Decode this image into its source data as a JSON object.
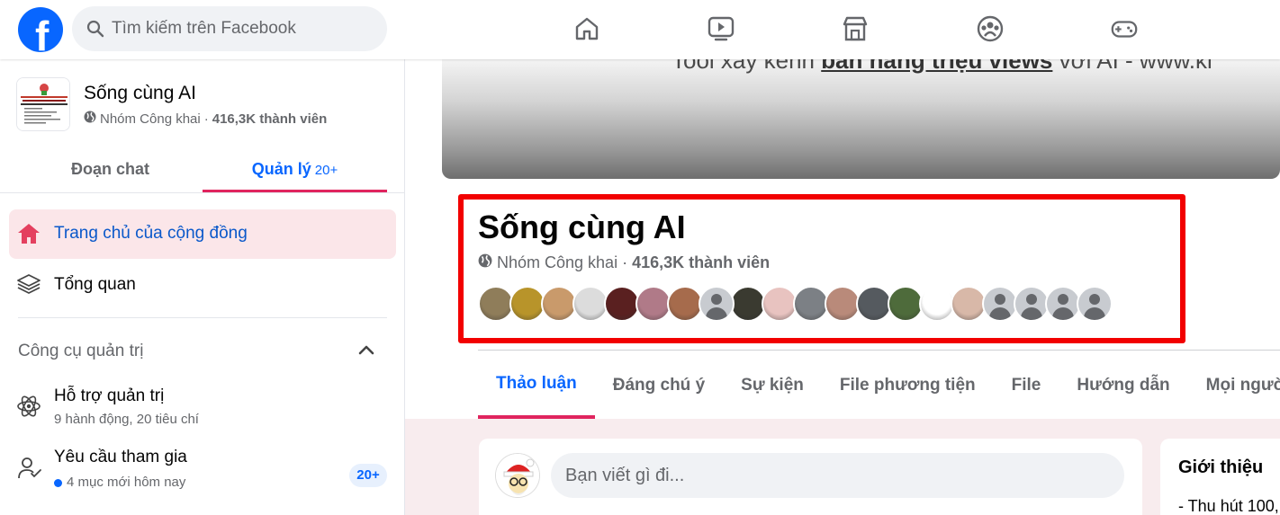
{
  "search": {
    "placeholder": "Tìm kiếm trên Facebook"
  },
  "nav_icons": [
    "home-icon",
    "video-icon",
    "marketplace-icon",
    "groups-icon",
    "gaming-icon"
  ],
  "group": {
    "name": "Sống cùng AI",
    "privacy": "Nhóm Công khai",
    "separator": "·",
    "members": "416,3K thành viên"
  },
  "sidebar": {
    "tabs": {
      "chat": "Đoạn chat",
      "manage": "Quản lý",
      "manage_count": "20+"
    },
    "home": "Trang chủ của cộng đồng",
    "overview": "Tổng quan",
    "admin_tools_title": "Công cụ quản trị",
    "admin_assist": {
      "label": "Hỗ trợ quản trị",
      "sub": "9 hành động, 20 tiêu chí"
    },
    "join_requests": {
      "label": "Yêu cầu tham gia",
      "sub": "4 mục mới hôm nay",
      "badge": "20+"
    }
  },
  "cover": {
    "text_before": "Tool xây kênh",
    "text_underlined": "bán hàng triệu views",
    "text_after": "với AI  -  www.ki"
  },
  "main": {
    "title": "Sống cùng AI",
    "tabs": [
      "Thảo luận",
      "Đáng chú ý",
      "Sự kiện",
      "File phương tiện",
      "File",
      "Hướng dẫn",
      "Mọi người"
    ],
    "active_tab": "Thảo luận",
    "composer_placeholder": "Bạn viết gì đi...",
    "intro_title": "Giới thiệu",
    "intro_text": "- Thu hút 100,"
  },
  "member_avatars": [
    "#8f7d5a",
    "#b8942a",
    "#c99a6b",
    "#dcdcdc",
    "#5a2020",
    "#b07a88",
    "#a66b4c",
    "gray",
    "#3a3a30",
    "#e8c3c0",
    "#7c8085",
    "#b98a7a",
    "#555a5f",
    "#4e6b3b",
    "#ffffff",
    "#d8b8a8",
    "gray",
    "gray",
    "gray",
    "gray"
  ],
  "colors": {
    "facebook_blue": "#0866ff",
    "highlight_red": "#f20000",
    "active_underline": "#e0245e"
  }
}
